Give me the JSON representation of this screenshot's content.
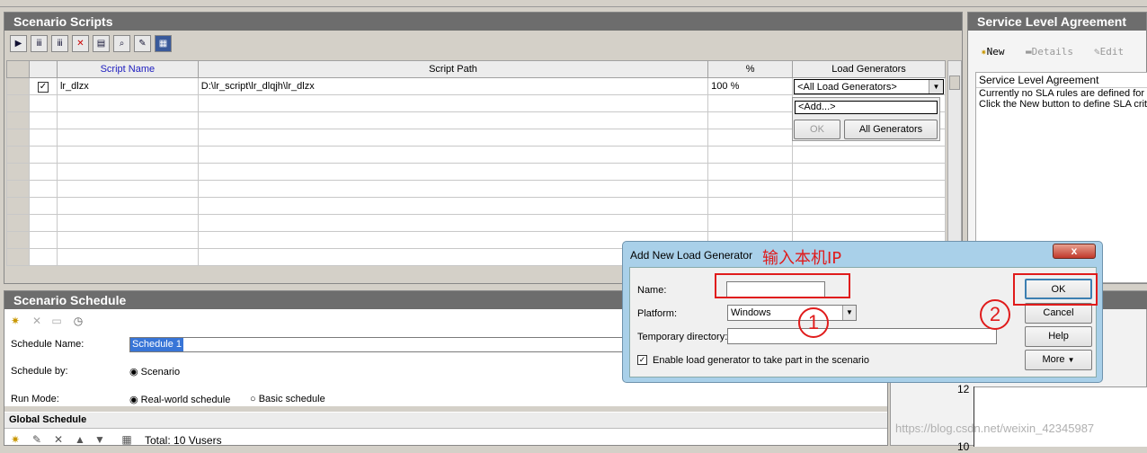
{
  "scenario_scripts": {
    "title": "Scenario Scripts",
    "columns": [
      "Script Name",
      "Script Path",
      "%",
      "Load Generators"
    ],
    "rows": [
      {
        "name": "lr_dlzx",
        "path": "D:\\lr_script\\lr_dlqjh\\lr_dlzx",
        "percent": "100 %",
        "generator": "<All Load Generators>"
      }
    ],
    "dropdown": {
      "add": "<Add...>",
      "ok": "OK",
      "all": "All Generators"
    }
  },
  "sla": {
    "title": "Service Level Agreement",
    "new": "New",
    "details": "Details",
    "edit": "Edit",
    "header": "Service Level Agreement",
    "line1": "Currently no SLA rules are defined for",
    "line2": "Click the New button to define SLA crit"
  },
  "schedule": {
    "title": "Scenario Schedule",
    "name_label": "Schedule Name:",
    "name_value": "Schedule 1",
    "by_label": "Schedule by:",
    "by_value": "Scenario",
    "mode_label": "Run Mode:",
    "mode_real": "Real-world schedule",
    "mode_basic": "Basic schedule",
    "global_title": "Global Schedule",
    "total": "Total: 10 Vusers"
  },
  "dialog": {
    "title": "Add New Load Generator",
    "annotation": "输入本机IP",
    "name_label": "Name:",
    "name_value": "",
    "platform_label": "Platform:",
    "platform_value": "Windows",
    "temp_label": "Temporary directory:",
    "temp_value": "",
    "enable_label": "Enable load generator to take part in the scenario",
    "ok": "OK",
    "cancel": "Cancel",
    "help": "Help",
    "more": "More",
    "circle1": "1",
    "circle2": "2",
    "close": "x"
  },
  "chart": {
    "tick12": "12",
    "tick10": "10"
  },
  "watermark": "https://blog.csdn.net/weixin_42345987"
}
